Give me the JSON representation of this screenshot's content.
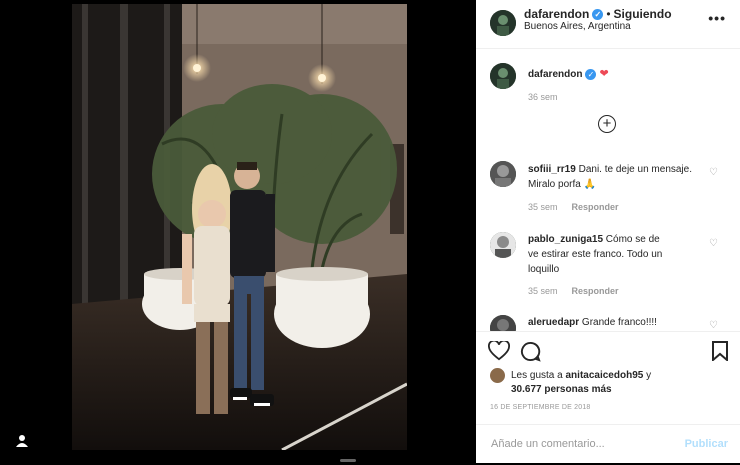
{
  "post": {
    "username": "dafarendon",
    "follow_status": "Siguiendo",
    "location": "Buenos Aires, Argentina",
    "caption": "❤",
    "caption_time": "36 sem",
    "likes_first_user": "anitacaicedoh95",
    "likes_prefix": "Les gusta a",
    "likes_suffix": "y",
    "likes_count_text": "30.677 personas más",
    "date": "16 DE SEPTIEMBRE DE 2018",
    "comment_placeholder": "Añade un comentario...",
    "publish_label": "Publicar"
  },
  "comments": [
    {
      "user": "sofiii_rr19",
      "text": "Dani. te deje un mensaje. Miralo porfa 🙏",
      "time": "35 sem",
      "reply": "Responder"
    },
    {
      "user": "pablo_zuniga15",
      "text": "Cómo se de ve estirar este franco. Todo un loquillo",
      "time": "35 sem",
      "reply": "Responder"
    },
    {
      "user": "aleruedapr",
      "text": "Grande franco!!!!",
      "time": "",
      "reply": ""
    }
  ],
  "icons": {
    "more": "more-options-icon",
    "heart": "heart-icon",
    "comment": "comment-icon",
    "save": "bookmark-icon",
    "add": "plus-circle-icon",
    "verified": "verified-badge-icon",
    "user_tag": "user-tag-icon"
  },
  "colors": {
    "verified": "#3897f0",
    "heart": "#ed4956",
    "publish": "#b2dffc"
  }
}
